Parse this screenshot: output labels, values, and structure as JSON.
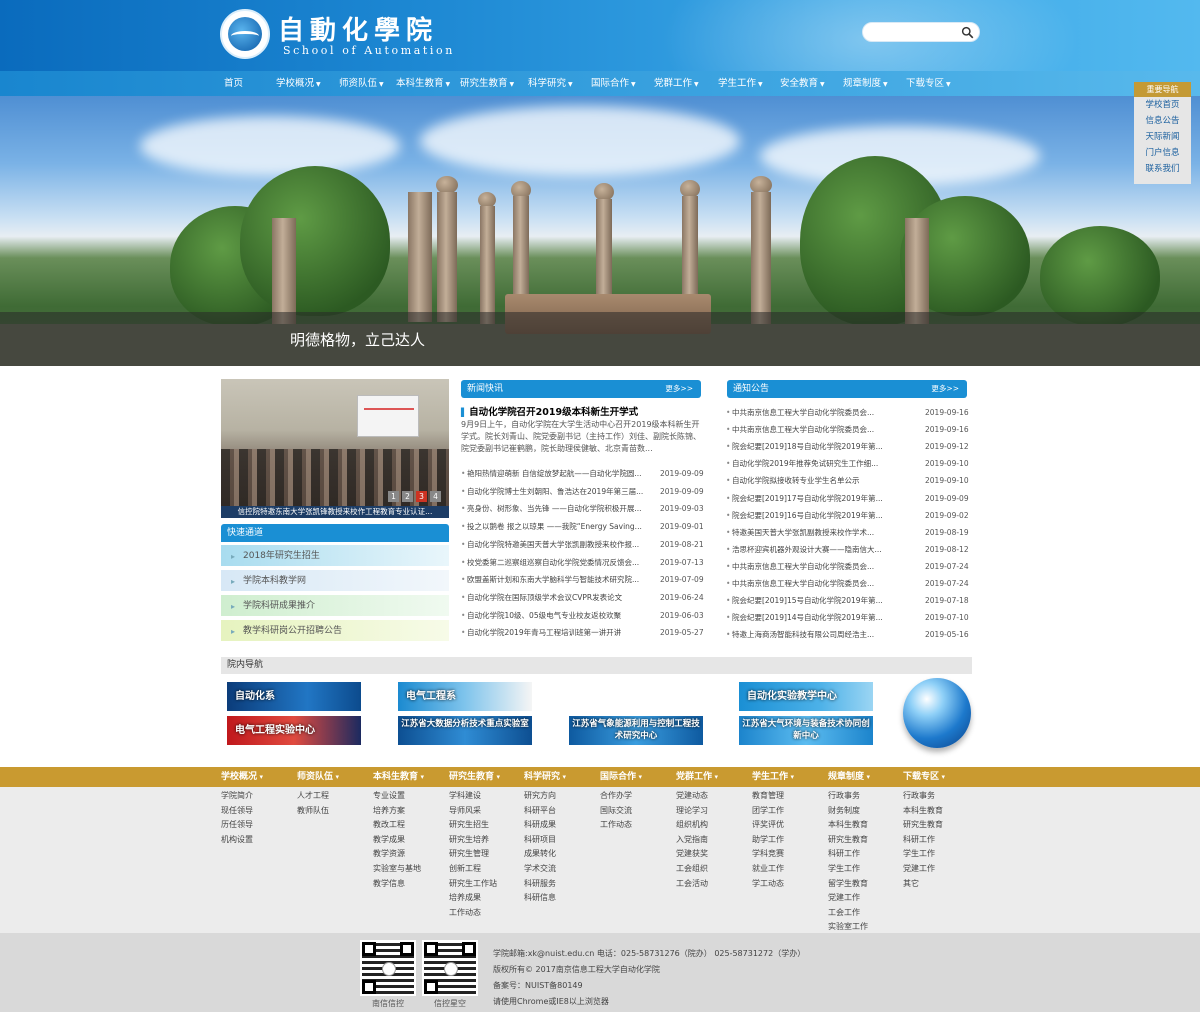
{
  "header": {
    "site_name": "自動化學院",
    "site_name_en": "School of Automation",
    "search_placeholder": ""
  },
  "nav": [
    {
      "label": "首页",
      "has_menu": false
    },
    {
      "label": "学校概况",
      "has_menu": true
    },
    {
      "label": "师资队伍",
      "has_menu": true
    },
    {
      "label": "本科生教育",
      "has_menu": true
    },
    {
      "label": "研究生教育",
      "has_menu": true
    },
    {
      "label": "科学研究",
      "has_menu": true
    },
    {
      "label": "国际合作",
      "has_menu": true
    },
    {
      "label": "党群工作",
      "has_menu": true
    },
    {
      "label": "学生工作",
      "has_menu": true
    },
    {
      "label": "安全教育",
      "has_menu": true
    },
    {
      "label": "规章制度",
      "has_menu": true
    },
    {
      "label": "下载专区",
      "has_menu": true
    }
  ],
  "banner": {
    "caption": "明德格物，立己达人"
  },
  "side_nav": {
    "title": "重要导航",
    "links": [
      "学校首页",
      "信息公告",
      "天际新闻",
      "门户信息",
      "联系我们"
    ]
  },
  "slider": {
    "caption": "信控院特邀东南大学张凯锋教授来校作工程教育专业认证...",
    "pages": [
      "1",
      "2",
      "3",
      "4"
    ],
    "active_page": "3"
  },
  "quick_access": {
    "title": "快速通道",
    "links": [
      "2018年研究生招生",
      "学院本科教学网",
      "学院科研成果推介",
      "教学科研岗公开招聘公告"
    ]
  },
  "news": {
    "title": "新闻快讯",
    "more": "更多>>",
    "featured_title": "自动化学院召开2019级本科新生开学式",
    "featured_summary": "9月9日上午，自动化学院在大学生活动中心召开2019级本科新生开学式。院长刘青山、院党委副书记（主持工作）刘佳、副院长陈锦、院党委副书记崔鹤鹏，院长助理侯健敏、北京青苗数...",
    "items": [
      {
        "title": "艳阳热情迎萌新 自信绽放梦起航——自动化学院圆...",
        "date": "2019-09-09"
      },
      {
        "title": "自动化学院博士生刘朝阳、鲁浩达在2019年第三届...",
        "date": "2019-09-09"
      },
      {
        "title": "亮身份、树形象、当先锋 ——自动化学院积极开展...",
        "date": "2019-09-03"
      },
      {
        "title": "投之以鹅卷 报之以琼果 ——我院“Energy Saving...",
        "date": "2019-09-01"
      },
      {
        "title": "自动化学院特邀美国天普大学张凯副教授来校作报...",
        "date": "2019-08-21"
      },
      {
        "title": "校党委第二巡察组巡察自动化学院党委情况反馈会...",
        "date": "2019-07-13"
      },
      {
        "title": "欧盟盖斯计划和东南大学脑科学与智能技术研究院...",
        "date": "2019-07-09"
      },
      {
        "title": "自动化学院在国际顶级学术会议CVPR发表论文",
        "date": "2019-06-24"
      },
      {
        "title": "自动化学院10级、05级电气专业校友返校欢聚",
        "date": "2019-06-03"
      },
      {
        "title": "自动化学院2019年青马工程培训班第一讲开讲",
        "date": "2019-05-27"
      }
    ]
  },
  "notices": {
    "title": "通知公告",
    "more": "更多>>",
    "items": [
      {
        "title": "中共南京信息工程大学自动化学院委员会...",
        "date": "2019-09-16"
      },
      {
        "title": "中共南京信息工程大学自动化学院委员会...",
        "date": "2019-09-16"
      },
      {
        "title": "院会纪要[2019]18号自动化学院2019年第...",
        "date": "2019-09-12"
      },
      {
        "title": "自动化学院2019年推荐免试研究生工作细...",
        "date": "2019-09-10"
      },
      {
        "title": "自动化学院拟接收转专业学生名单公示",
        "date": "2019-09-10"
      },
      {
        "title": "院会纪要[2019]17号自动化学院2019年第...",
        "date": "2019-09-09"
      },
      {
        "title": "院会纪要[2019]16号自动化学院2019年第...",
        "date": "2019-09-02"
      },
      {
        "title": "特邀美国天普大学张凯副教授来校作学术...",
        "date": "2019-08-19"
      },
      {
        "title": "浩思杯迎宾机器外观设计大赛——隐南信大...",
        "date": "2019-08-12"
      },
      {
        "title": "中共南京信息工程大学自动化学院委员会...",
        "date": "2019-07-24"
      },
      {
        "title": "中共南京信息工程大学自动化学院委员会...",
        "date": "2019-07-24"
      },
      {
        "title": "院会纪要[2019]15号自动化学院2019年第...",
        "date": "2019-07-18"
      },
      {
        "title": "院会纪要[2019]14号自动化学院2019年第...",
        "date": "2019-07-10"
      },
      {
        "title": "特邀上海商汤智能科技有限公司周经浩主...",
        "date": "2019-05-16"
      }
    ]
  },
  "departments": {
    "title": "院内导航",
    "links": [
      "自动化系",
      "电气工程系",
      "自动化实验教学中心",
      "电气工程实验中心",
      "江苏省大数据分析技术重点实验室",
      "江苏省气象能源利用与控制工程技术研究中心",
      "江苏省大气环境与装备技术协同创新中心"
    ]
  },
  "footer": {
    "columns": [
      {
        "title": "学校概况",
        "items": [
          "学院简介",
          "现任领导",
          "历任领导",
          "机构设置"
        ]
      },
      {
        "title": "师资队伍",
        "items": [
          "人才工程",
          "教师队伍"
        ]
      },
      {
        "title": "本科生教育",
        "items": [
          "专业设置",
          "培养方案",
          "教改工程",
          "教学成果",
          "教学资源",
          "实验室与基地",
          "教学信息"
        ]
      },
      {
        "title": "研究生教育",
        "items": [
          "学科建设",
          "导师风采",
          "研究生招生",
          "研究生培养",
          "研究生管理",
          "创新工程",
          "研究生工作站",
          "培养成果",
          "工作动态"
        ]
      },
      {
        "title": "科学研究",
        "items": [
          "研究方向",
          "科研平台",
          "科研成果",
          "科研项目",
          "成果转化",
          "学术交流",
          "科研服务",
          "科研信息"
        ]
      },
      {
        "title": "国际合作",
        "items": [
          "合作办学",
          "国际交流",
          "工作动态"
        ]
      },
      {
        "title": "党群工作",
        "items": [
          "党建动态",
          "理论学习",
          "组织机构",
          "入党指南",
          "党建获奖",
          "工会组织",
          "工会活动"
        ]
      },
      {
        "title": "学生工作",
        "items": [
          "教育管理",
          "团学工作",
          "评奖评优",
          "助学工作",
          "学科竞赛",
          "就业工作",
          "学工动态"
        ]
      },
      {
        "title": "规章制度",
        "items": [
          "行政事务",
          "财务制度",
          "本科生教育",
          "研究生教育",
          "科研工作",
          "学生工作",
          "留学生教育",
          "党建工作",
          "工会工作",
          "实验室工作"
        ]
      },
      {
        "title": "下载专区",
        "items": [
          "行政事务",
          "本科生教育",
          "研究生教育",
          "科研工作",
          "学生工作",
          "党建工作",
          "其它"
        ]
      }
    ],
    "qr_labels": [
      "南信信控",
      "信控星空"
    ],
    "info": [
      "学院邮箱:xk@nuist.edu.cn 电话：025-58731276（院办） 025-58731272（学办）",
      "版权所有© 2017南京信息工程大学自动化学院",
      "备案号：NUIST备80149",
      "请使用Chrome或IE8以上浏览器"
    ]
  }
}
